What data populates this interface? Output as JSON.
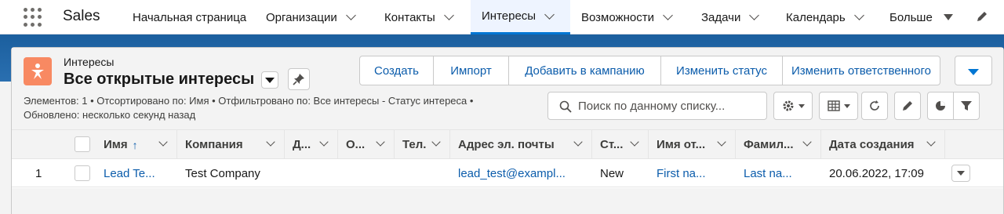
{
  "app": {
    "name": "Sales"
  },
  "nav": {
    "items": [
      {
        "label": "Начальная страница"
      },
      {
        "label": "Организации"
      },
      {
        "label": "Контакты"
      },
      {
        "label": "Интересы"
      },
      {
        "label": "Возможности"
      },
      {
        "label": "Задачи"
      },
      {
        "label": "Календарь"
      },
      {
        "label": "Больше"
      }
    ],
    "active": "Интересы"
  },
  "listview": {
    "object_label": "Интересы",
    "title": "Все открытые интересы",
    "meta_line1": "Элементов: 1 • Отсортировано по: Имя • Отфильтровано по: Все интересы - Статус интереса •",
    "meta_line2": "Обновлено: несколько секунд назад",
    "search_placeholder": "Поиск по данному списку...",
    "buttons": [
      "Создать",
      "Импорт",
      "Добавить в кампанию",
      "Изменить статус",
      "Изменить ответственного"
    ]
  },
  "table": {
    "columns": [
      "Имя",
      "Компания",
      "Д...",
      "О...",
      "Тел.",
      "Адрес эл. почты",
      "Ст...",
      "Имя от...",
      "Фамил...",
      "Дата создания"
    ],
    "sorted_column": "Имя",
    "rows": [
      {
        "num": "1",
        "cells": [
          "Lead Te...",
          "Test Company",
          "",
          "",
          "",
          "lead_test@exampl...",
          "New",
          "First na...",
          "Last na...",
          "20.06.2022, 17:09"
        ]
      }
    ]
  },
  "colors": {
    "accent": "#0176d3",
    "link": "#0b5cab",
    "lead_icon": "#f88962",
    "band": "#1b5f9e"
  }
}
